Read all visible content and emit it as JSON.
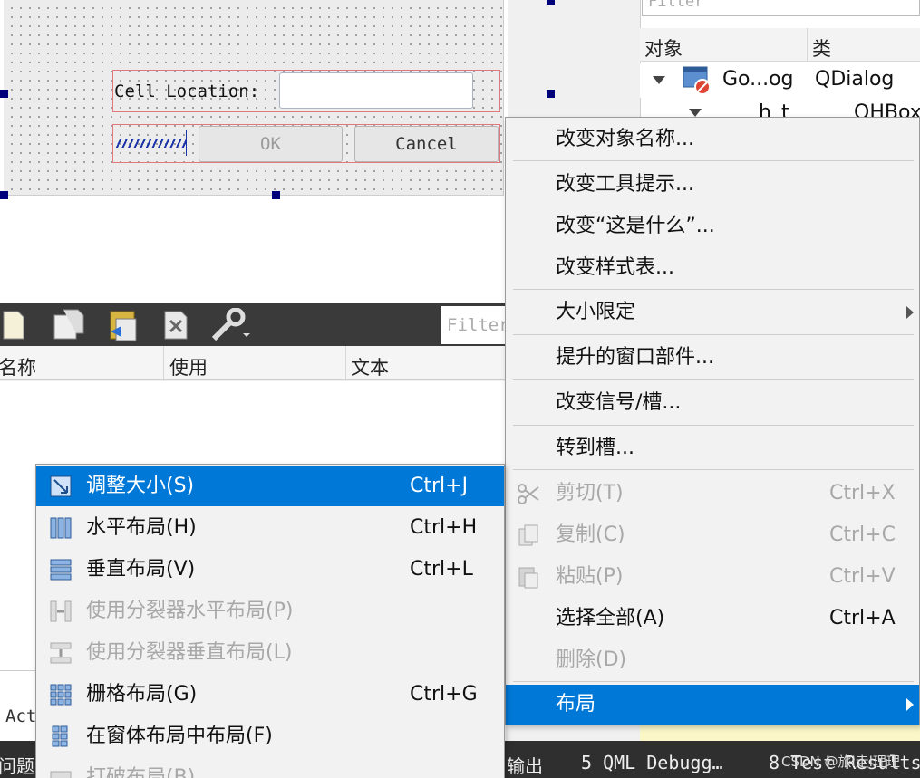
{
  "form": {
    "cell_label": "Cell Location:",
    "ok_label": "OK",
    "cancel_label": "Cancel"
  },
  "inspector": {
    "filter_placeholder": "Filter",
    "col_object": "对象",
    "col_class": "类",
    "row1_name": "Go...og",
    "row1_class": "QDialog",
    "row2_name": "h_t",
    "row2_class": "QHBox"
  },
  "widget_box": {
    "filter_placeholder": "Filter",
    "col_name": "名称",
    "col_use": "使用",
    "col_text": "文本"
  },
  "main_menu": {
    "items": [
      {
        "label": "改变对象名称...",
        "shortcut": ""
      },
      {
        "label": "改变工具提示...",
        "shortcut": ""
      },
      {
        "label": "改变“这是什么”...",
        "shortcut": ""
      },
      {
        "label": "改变样式表...",
        "shortcut": ""
      },
      {
        "label": "大小限定",
        "shortcut": ""
      },
      {
        "label": "提升的窗口部件...",
        "shortcut": ""
      },
      {
        "label": "改变信号/槽...",
        "shortcut": ""
      },
      {
        "label": "转到槽...",
        "shortcut": ""
      },
      {
        "label": "剪切(T)",
        "shortcut": "Ctrl+X",
        "disabled": true,
        "icon": "scissors-icon"
      },
      {
        "label": "复制(C)",
        "shortcut": "Ctrl+C",
        "disabled": true,
        "icon": "copy-icon"
      },
      {
        "label": "粘贴(P)",
        "shortcut": "Ctrl+V",
        "disabled": true,
        "icon": "paste-icon"
      },
      {
        "label": "选择全部(A)",
        "shortcut": "Ctrl+A"
      },
      {
        "label": "删除(D)",
        "shortcut": "",
        "disabled": true
      },
      {
        "label": "布局",
        "shortcut": "",
        "selected": true
      }
    ]
  },
  "layout_menu": {
    "items": [
      {
        "label": "调整大小(S)",
        "shortcut": "Ctrl+J",
        "selected": true,
        "icon": "adjust-size-icon"
      },
      {
        "label": "水平布局(H)",
        "shortcut": "Ctrl+H",
        "icon": "horizontal-layout-icon"
      },
      {
        "label": "垂直布局(V)",
        "shortcut": "Ctrl+L",
        "icon": "vertical-layout-icon"
      },
      {
        "label": "使用分裂器水平布局(P)",
        "shortcut": "",
        "disabled": true,
        "icon": "h-splitter-icon"
      },
      {
        "label": "使用分裂器垂直布局(L)",
        "shortcut": "",
        "disabled": true,
        "icon": "v-splitter-icon"
      },
      {
        "label": "栅格布局(G)",
        "shortcut": "Ctrl+G",
        "icon": "grid-layout-icon"
      },
      {
        "label": "在窗体布局中布局(F)",
        "shortcut": "",
        "icon": "form-layout-icon"
      },
      {
        "label": "打破布局(B)",
        "shortcut": "",
        "disabled": true,
        "icon": "break-layout-icon"
      }
    ]
  },
  "lower": {
    "act_label": "Act",
    "status_problems": "问题",
    "status_output": "输出",
    "status_qml": "5  QML Debugg…",
    "status_test": "8  Test Results",
    "watermark": "CSDN @旅i走l理理"
  },
  "colors": {
    "accent": "#0078d7",
    "menu_bg": "#f2f2f2",
    "disabled": "#a8a8a8"
  }
}
